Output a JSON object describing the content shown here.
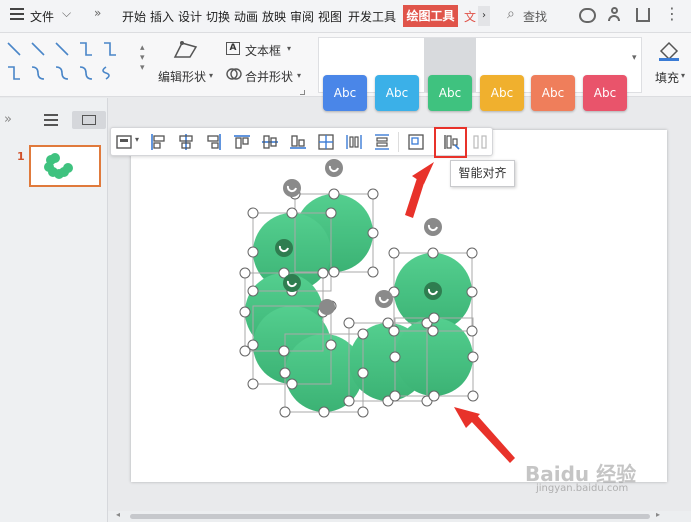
{
  "menubar": {
    "file_label": "文件",
    "tabs": [
      "开始",
      "插入",
      "设计",
      "切换",
      "动画",
      "放映",
      "审阅",
      "视图",
      "开发工具"
    ],
    "active_tab": "绘图工具",
    "overflow_tab": "文",
    "search_label": "查找"
  },
  "ribbon": {
    "edit_shape": "编辑形状",
    "text_box": "文本框",
    "merge_shape": "合并形状",
    "style_label": "Abc",
    "fill_label": "填充",
    "style_colors": [
      "#4a86e8",
      "#3bb0e8",
      "#3fc27f",
      "#f0b02e",
      "#ef7e5b",
      "#e9546b"
    ]
  },
  "leftpanel": {
    "slide_number": "1"
  },
  "floatbar": {
    "tooltip": "智能对齐"
  },
  "watermark": {
    "main": "Baidu 经验",
    "sub": "jingyan.baidu.com"
  }
}
